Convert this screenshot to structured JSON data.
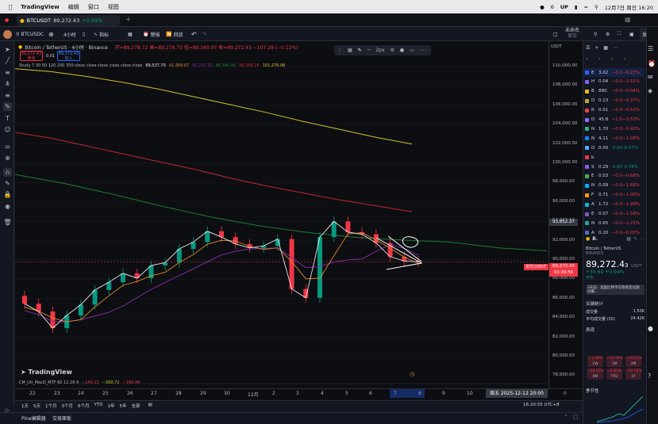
{
  "menubar": {
    "app": "TradingView",
    "items": [
      "编辑",
      "窗口",
      "视图"
    ],
    "badge": "6",
    "user": "UP",
    "datetime": "12月7日 周日  16:20"
  },
  "tab": {
    "title": "BTCUSDT",
    "price": "89,272.43",
    "change": "+0.04%"
  },
  "toolbar": {
    "symbol": "BTCUSDC",
    "interval": "4小时",
    "indicators": "指标",
    "alerts": "警报",
    "replay": "回放",
    "unnamed": "未命名",
    "save": "保存",
    "publish": "发布"
  },
  "legend": {
    "title": "Bitcoin / TetherUS · 4小时 · Binance",
    "ohlc": "开=89,278.72 高=89,279.73 低=89,160.97 收=89,272.43 −107.29 (−0.12%)",
    "sell_price": "89,272.43",
    "sell_label": "卖出",
    "spread": "0.01",
    "buy_price": "89,272.43",
    "buy_label": "买入",
    "study_name": "Study 7 30 50 120 200 350 close close close close close close",
    "study_values": [
      "89,537.70",
      "91,309.67",
      "91,217.10",
      "86,380.46",
      "90,388.26",
      "101,276.98"
    ],
    "macd": "CM_Ult_MacD_MTF 60 12 26 9",
    "macd_values": [
      "−140.22",
      "−300.72",
      "−160.49"
    ]
  },
  "draw_toolbar": {
    "stroke": "2px"
  },
  "price_axis": {
    "labels": [
      "110,000.00",
      "108,000.00",
      "106,000.00",
      "104,000.00",
      "102,000.00",
      "100,000.00",
      "98,000.00",
      "96,000.00",
      "94,000.00",
      "92,000.00",
      "90,000.00",
      "88,000.00",
      "86,000.00",
      "84,000.00",
      "82,000.00",
      "80,000.00",
      "78,000.00"
    ],
    "currency": "USDT",
    "marker_high": "93,852.37",
    "marker_symbol": "BTCUSDT",
    "marker_price": "89,272.43",
    "marker_countdown": "03:39:56"
  },
  "time_axis": {
    "labels": [
      "22",
      "23",
      "24",
      "25",
      "26",
      "27",
      "28",
      "29",
      "30",
      "12月",
      "2",
      "3",
      "4",
      "5",
      "6",
      "7",
      "8",
      "9",
      "10"
    ],
    "crosshair": "周五 2025-12-12  20:00"
  },
  "ranges": [
    "1天",
    "5天",
    "1个月",
    "3个月",
    "6个月",
    "YTD",
    "1年",
    "5年",
    "全部"
  ],
  "clock": "16:20:55 UTC+8",
  "footer": {
    "pine": "Pine编辑器",
    "panel": "交易面板"
  },
  "watchlist": [
    {
      "sym": "E",
      "last": "3.02",
      "chg": "−0.1",
      "pct": "−0.27%",
      "color": "#2962ff",
      "dir": "red"
    },
    {
      "sym": "H",
      "last": "0.04",
      "chg": "−0.0",
      "pct": "−2.51%",
      "color": "#7b61ff",
      "dir": "red"
    },
    {
      "sym": "B",
      "last": "890.",
      "chg": "−0.3",
      "pct": "−0.04%",
      "color": "#f0b90b",
      "dir": "red"
    },
    {
      "sym": "D",
      "last": "0.13",
      "chg": "−0.0",
      "pct": "−0.37%",
      "color": "#c2a633",
      "dir": "red"
    },
    {
      "sym": "R",
      "last": "0.01",
      "chg": "−0.0",
      "pct": "−0.53%",
      "color": "#e84142",
      "dir": "red"
    },
    {
      "sym": "D",
      "last": "45.8",
      "chg": "−1.5",
      "pct": "−3.53%",
      "color": "#8e6cff",
      "dir": "red"
    },
    {
      "sym": "N",
      "last": "1.70",
      "chg": "−0.0",
      "pct": "−0.41%",
      "color": "#2fb67c",
      "dir": "red"
    },
    {
      "sym": "N",
      "last": "4.11",
      "chg": "−0.0",
      "pct": "−1.08%",
      "color": "#0a84ff",
      "dir": "red"
    },
    {
      "sym": "D",
      "last": "0.00",
      "chg": "0.00",
      "pct": "8.57%",
      "color": "#4cb1ff",
      "dir": "green"
    },
    {
      "sym": "b",
      "last": "",
      "chg": "",
      "pct": "",
      "color": "#f23645",
      "dir": "red"
    },
    {
      "sym": "S",
      "last": "0.29",
      "chg": "0.00",
      "pct": "0.78%",
      "color": "#8a5cf6",
      "dir": "green"
    },
    {
      "sym": "E",
      "last": "0.03",
      "chg": "−0.0",
      "pct": "−0.68%",
      "color": "#4caf50",
      "dir": "red"
    },
    {
      "sym": "N",
      "last": "0.09",
      "chg": "−0.0",
      "pct": "−1.68%",
      "color": "#00b0ff",
      "dir": "red"
    },
    {
      "sym": "F",
      "last": "0.71",
      "chg": "−0.0",
      "pct": "−1.00%",
      "color": "#ff9800",
      "dir": "red"
    },
    {
      "sym": "A",
      "last": "1.72",
      "chg": "−0.0",
      "pct": "−1.99%",
      "color": "#00bcd4",
      "dir": "red"
    },
    {
      "sym": "E",
      "last": "0.07",
      "chg": "−0.0",
      "pct": "−1.58%",
      "color": "#7e57c2",
      "dir": "red"
    },
    {
      "sym": "N",
      "last": "0.65",
      "chg": "−0.0",
      "pct": "−1.21%",
      "color": "#26a69a",
      "dir": "red"
    },
    {
      "sym": "A",
      "last": "0.20",
      "chg": "−0.0",
      "pct": "−0.05%",
      "color": "#5c6bc0",
      "dir": "red"
    }
  ],
  "details": {
    "sym": "B.",
    "name": "Bitcoin / TetherUS",
    "exchange": "BINANCE",
    "price": "89,272.4",
    "price_tail": "3",
    "unit": "USDT",
    "change": "+35.64",
    "change_pct": "+0.04%",
    "status": "开市",
    "news": "3天前 · 美国比特币在政策变化期间最...",
    "stats_title": "关键统计",
    "vol_label": "成交量",
    "vol_value": "1.50K",
    "avgvol_label": "平均成交量 (30)",
    "avgvol_value": "24.42K",
    "perf_title": "表现",
    "season_title": "季节性",
    "perf": [
      {
        "v": "−1.08%",
        "p": "1W"
      },
      {
        "v": "−11.74%",
        "p": "1M"
      },
      {
        "v": "−24.51%",
        "p": "3M"
      },
      {
        "v": "−16.95%",
        "p": "6M"
      },
      {
        "v": "−4.81%",
        "p": "YTD"
      },
      {
        "v": "−12.32%",
        "p": "1Y"
      }
    ]
  },
  "colors": {
    "up": "#089981",
    "down": "#f23645",
    "accent": "#2962ff",
    "yellow": "#d4c22a",
    "ma_red": "#c2262e",
    "ma_green": "#1f7a2e",
    "ma_orange": "#e08a2c",
    "ma_purple": "#8a2fa8",
    "ma_white": "#e6e6e6"
  },
  "chart_data": {
    "type": "candlestick",
    "symbol": "BTCUSDT",
    "interval": "4h",
    "ylim": [
      77000,
      111000
    ],
    "x_labels": [
      "22",
      "23",
      "24",
      "25",
      "26",
      "27",
      "28",
      "29",
      "30",
      "12月",
      "2",
      "3",
      "4",
      "5",
      "6",
      "7",
      "8",
      "9",
      "10"
    ],
    "close_approx": [
      85000,
      84200,
      82500,
      83800,
      84900,
      86400,
      87200,
      88100,
      87600,
      88900,
      89200,
      90600,
      91300,
      92400,
      91800,
      91100,
      90700,
      90900,
      91600,
      86500,
      85600,
      91800,
      93400,
      92300,
      92100,
      91200,
      89800,
      89350,
      89272
    ],
    "series": [
      {
        "name": "MA350",
        "values": [
          109000,
          108700,
          108200,
          107600,
          106900,
          106100,
          105300,
          104500,
          103600,
          102800,
          102000,
          101300
        ]
      },
      {
        "name": "MA200",
        "values": [
          102500,
          101900,
          101100,
          100300,
          99500,
          98700,
          97800,
          97000,
          96300,
          95600,
          95000,
          94400
        ]
      },
      {
        "name": "MA120",
        "values": [
          98200,
          97300,
          96200,
          95000,
          93900,
          93000,
          92300,
          91800,
          91500,
          91300,
          90700,
          90400
        ]
      }
    ]
  }
}
